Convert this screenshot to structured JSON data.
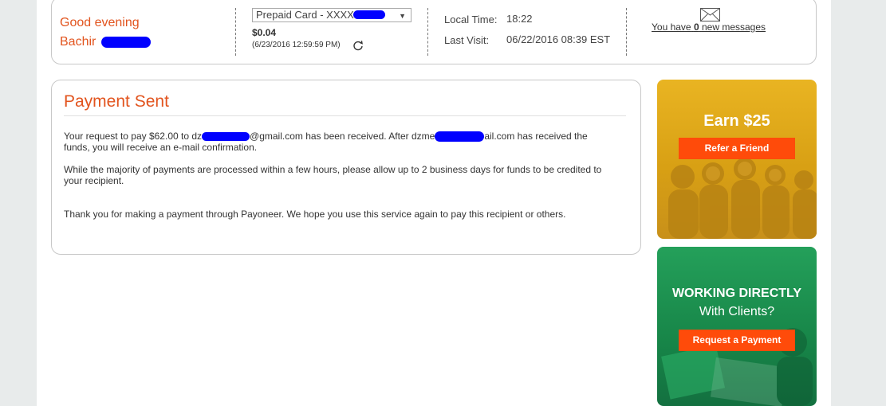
{
  "header": {
    "greeting": "Good evening",
    "user_first_name": "Bachir",
    "card_select_value": "Prepaid Card - XXXX",
    "balance": "$0.04",
    "balance_timestamp": "(6/23/2016 12:59:59 PM)",
    "local_time_label": "Local Time:",
    "local_time_value": "18:22",
    "last_visit_label": "Last Visit:",
    "last_visit_value": "06/22/2016 08:39 EST",
    "messages_prefix": "You have",
    "messages_count": "0",
    "messages_suffix": "new messages",
    "accent_color": "#e2541e"
  },
  "main": {
    "title": "Payment Sent",
    "p1_line1_a": "Your request to pay $62.00 to dz",
    "p1_line1_b": "@gmail.com has been received. After dzme",
    "p1_line1_c": "ail.com has received the",
    "p1_line2": "funds, you will receive an e-mail confirmation.",
    "p2_line1": "While the majority of payments are processed within a few hours, please allow up to 2 business days for funds to be credited to",
    "p2_line2": "your recipient.",
    "p3": "Thank you for making a payment through Payoneer. We hope you use this service again to pay this recipient or others."
  },
  "promos": {
    "refer": {
      "heading": "Earn $25",
      "button": "Refer a Friend",
      "color": "#e0ac1c"
    },
    "request": {
      "heading_line1": "WORKING DIRECTLY",
      "heading_line2": "With Clients?",
      "button": "Request a Payment",
      "color": "#1a8a4c"
    },
    "button_color": "#ff4b0a"
  },
  "icons": {
    "mail": "envelope-icon",
    "refresh": "refresh-icon"
  }
}
